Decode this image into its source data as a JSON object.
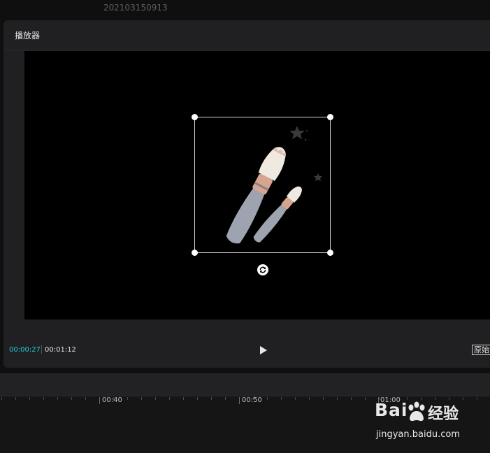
{
  "project": {
    "title": "202103150913"
  },
  "player": {
    "title": "播放器",
    "time_current": "00:00:27",
    "time_total": "00:01:12",
    "ratio_label": "原始"
  },
  "timeline": {
    "labels": [
      "00:40",
      "00:50",
      "01:00"
    ]
  },
  "watermark": {
    "logo": "Bai",
    "logo_suffix": "经验",
    "url": "jingyan.baidu.com"
  },
  "colors": {
    "accent_time": "#21c8d6",
    "brush_handle": "#9ea3b0",
    "brush_ferrule": "#d7a48f",
    "brush_bristles": "#efe9e2"
  },
  "icons": {
    "play": "play-icon",
    "rotate": "rotate-icon",
    "paw": "baidu-paw-icon"
  }
}
